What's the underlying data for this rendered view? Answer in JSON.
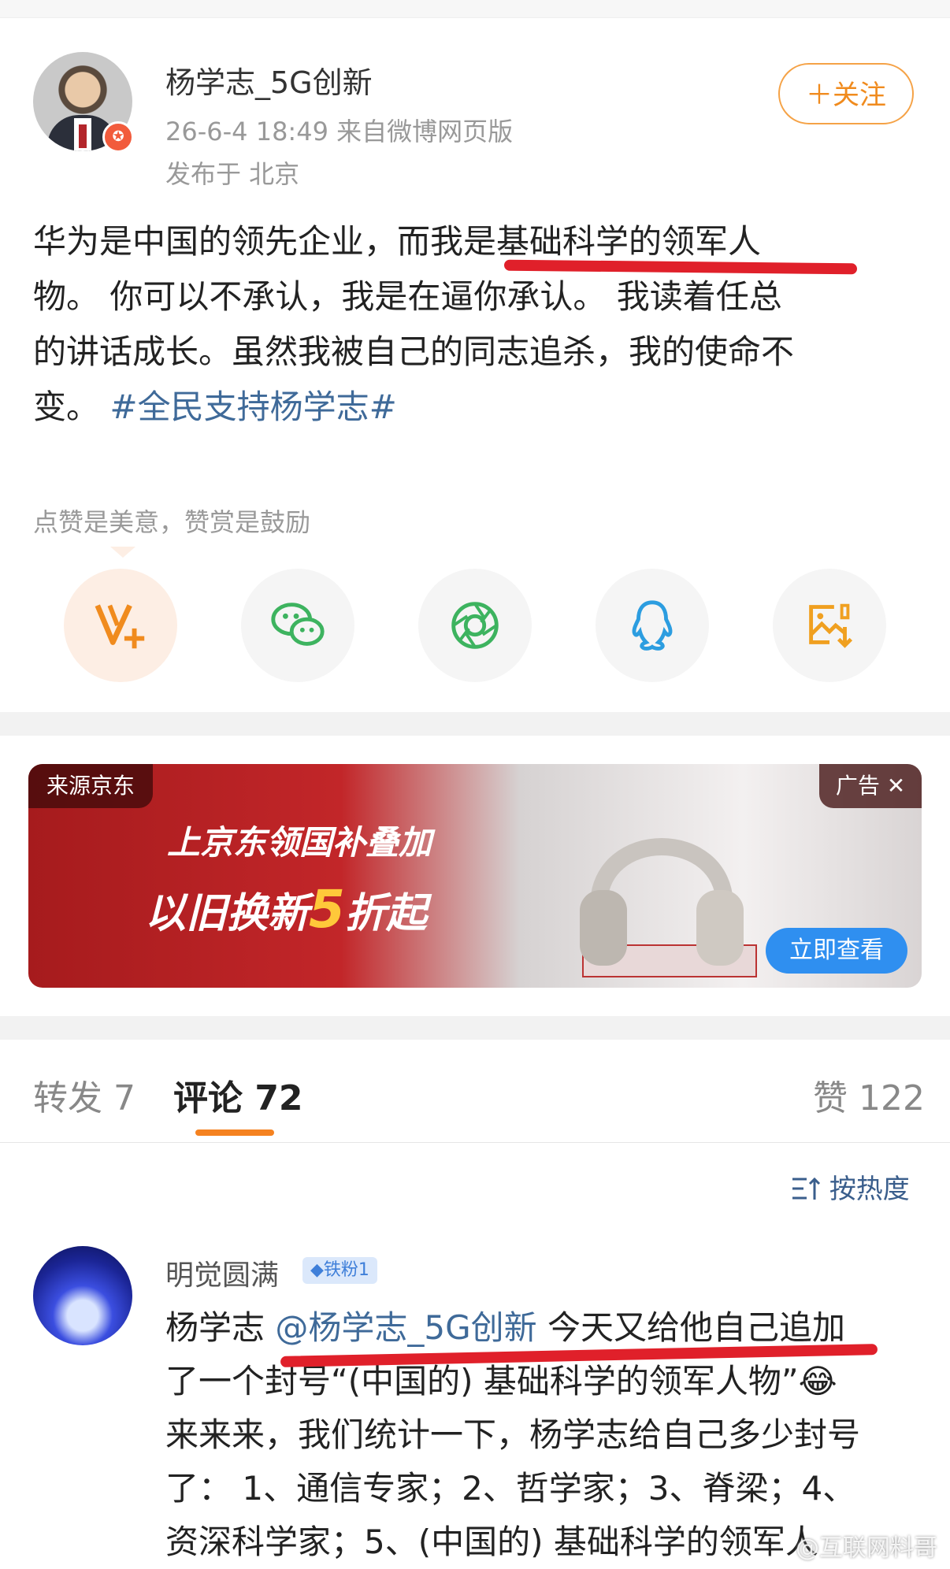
{
  "post": {
    "author": "杨学志_5G创新",
    "time_source": "26-6-4 18:49  来自微博网页版",
    "location": "发布于 北京",
    "follow_label": "＋关注",
    "body_lines": [
      "华为是中国的领先企业，而我是基础科学的领军人",
      "物。 你可以不承认，我是在逼你承认。 我读着任总",
      "的讲话成长。虽然我被自己的同志追杀，我的使命不",
      "变。"
    ],
    "hashtag": "#全民支持杨学志#",
    "reward_text": "点赞是美意，赞赏是鼓励"
  },
  "share_icons": [
    "v-plus-icon",
    "wechat-icon",
    "moments-icon",
    "qq-icon",
    "save-image-icon"
  ],
  "ad": {
    "source_label": "来源京东",
    "ad_label": "广告 ✕",
    "line1": "上京东领国补叠加",
    "line2_prefix": "以旧换新",
    "line2_num": "5",
    "line2_suffix": "折起",
    "cta": "立即查看"
  },
  "tabs": {
    "repost": "转发 7",
    "comments": "评论 72",
    "likes": "赞 122",
    "sort_label": "按热度"
  },
  "comment": {
    "name": "明觉圆满",
    "badge": "◆铁粉1",
    "text_prefix": "杨学志 ",
    "mention": "@杨学志_5G创新",
    "text_line1_rest": " 今天又给他自己追加",
    "text_line2": "了一个封号“(中国的) 基础科学的领军人物”😂",
    "text_line3": "来来来，我们统计一下，杨学志给自己多少封号",
    "text_line4": "了：  1、通信专家；2、哲学家；3、脊梁；4、",
    "text_line5": "资深科学家；5、(中国的) 基础科学的领军人"
  },
  "watermark": "@互联网料哥",
  "colors": {
    "accent_orange": "#f58220",
    "link_blue": "#3f6a99",
    "highlight_red": "#e0202a"
  }
}
